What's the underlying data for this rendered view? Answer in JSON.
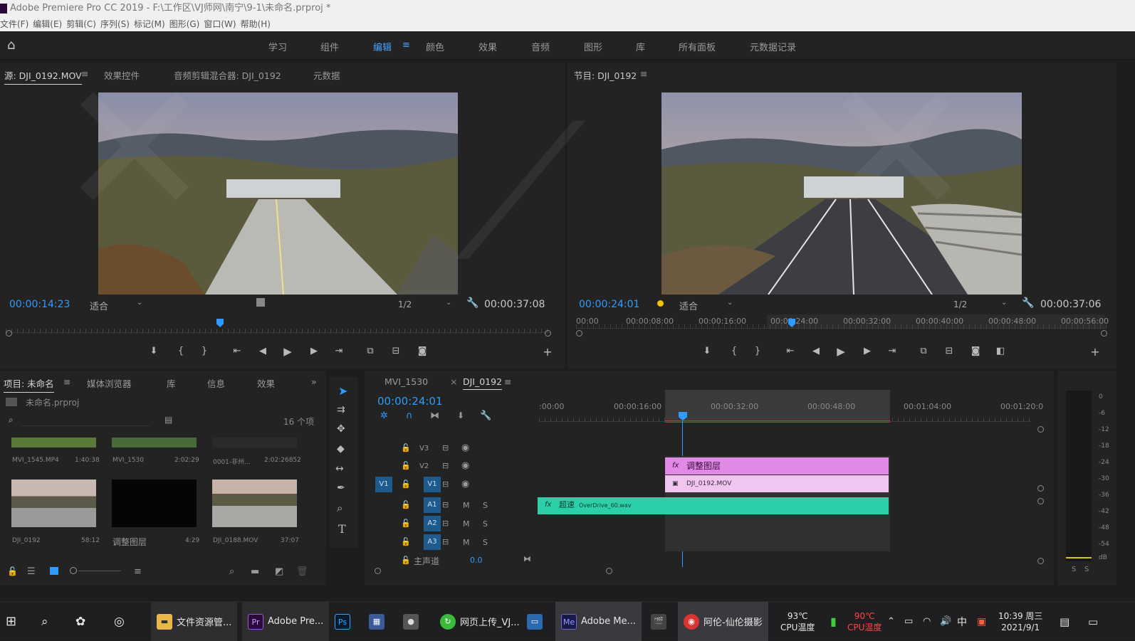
{
  "window": {
    "title": "Adobe Premiere Pro CC 2019 - F:\\工作区\\VJ师网\\南宁\\9-1\\未命名.prproj *",
    "controls": [
      "—",
      "❐",
      "✕"
    ]
  },
  "menu": [
    "文件(F)",
    "编辑(E)",
    "剪辑(C)",
    "序列(S)",
    "标记(M)",
    "图形(G)",
    "窗口(W)",
    "帮助(H)"
  ],
  "workspaces": [
    "学习",
    "组件",
    "编辑",
    "颜色",
    "效果",
    "音频",
    "图形",
    "库",
    "所有面板",
    "元数据记录"
  ],
  "active_workspace": "编辑",
  "source_panel": {
    "tabs": [
      "源: DJI_0192.MOV",
      "效果控件",
      "音频剪辑混合器: DJI_0192",
      "元数据"
    ],
    "timecode": "00:00:14:23",
    "fit": "适合",
    "resolution": "1/2",
    "duration": "00:00:37:08",
    "playhead_pct": 40
  },
  "program_panel": {
    "tabs": [
      "节目: DJI_0192"
    ],
    "timecode": "00:00:24:01",
    "fit": "适合",
    "resolution": "1/2",
    "duration": "00:00:37:06",
    "ruler": [
      "00:00",
      "00:00:08:00",
      "00:00:16:00",
      "00:00:24:00",
      "00:00:32:00",
      "00:00:40:00",
      "00:00:48:00",
      "00:00:56:00"
    ]
  },
  "project_panel": {
    "tabs": [
      "项目: 未命名",
      "媒体浏览器",
      "库",
      "信息",
      "效果"
    ],
    "project_file": "未命名.prproj",
    "item_count": "16 个项",
    "items": [
      {
        "name": "MVI_1545.MP4",
        "dur": "1:40:38"
      },
      {
        "name": "MVI_1530",
        "dur": "2:02:29"
      },
      {
        "name": "0001-非州...",
        "dur": "2:02:26852"
      },
      {
        "name": "DJI_0192",
        "dur": "58:12"
      },
      {
        "name": "调整图层",
        "dur": "4:29"
      },
      {
        "name": "DJI_0188.MOV",
        "dur": "37:07"
      }
    ]
  },
  "timeline": {
    "tabs": [
      "MVI_1530",
      "DJI_0192"
    ],
    "timecode": "00:00:24:01",
    "ruler": [
      ":00:00",
      "00:00:16:00",
      "00:00:32:00",
      "00:00:48:00",
      "00:01:04:00",
      "00:01:20:0"
    ],
    "tracks": [
      "V3",
      "V2",
      "V1",
      "A1",
      "A2",
      "A3"
    ],
    "source_patch": "V1",
    "master_label": "主声道",
    "master_value": "0.0",
    "clip_adjust": "调整图层",
    "clip_video": "DJI_0192.MOV",
    "clip_audio_title": "超速",
    "clip_audio_file": "OverDrive_60.wav",
    "track_letters": {
      "m": "M",
      "s": "S"
    }
  },
  "meter": {
    "ticks": [
      "0",
      "-6",
      "-12",
      "-18",
      "-24",
      "-30",
      "-36",
      "-42",
      "-48",
      "-54",
      "dB"
    ],
    "solo": [
      "S",
      "S"
    ]
  },
  "taskbar": {
    "apps": [
      "文件资源管...",
      "Adobe Pre...",
      "网页上传_VJ...",
      "Adobe Me...",
      "阿伦-仙伦摄影"
    ],
    "cpu_temp1": "93℃",
    "cpu_label1": "CPU温度",
    "cpu_temp2": "90℃",
    "cpu_label2": "CPU温度",
    "ime": "中",
    "time": "10:39 周三",
    "date": "2021/9/1"
  },
  "colors": {
    "accent": "#2f9bff",
    "adjust_clip": "#e08ae6",
    "audio_clip": "#2bd0a8",
    "patch": "#1d5a8e"
  }
}
